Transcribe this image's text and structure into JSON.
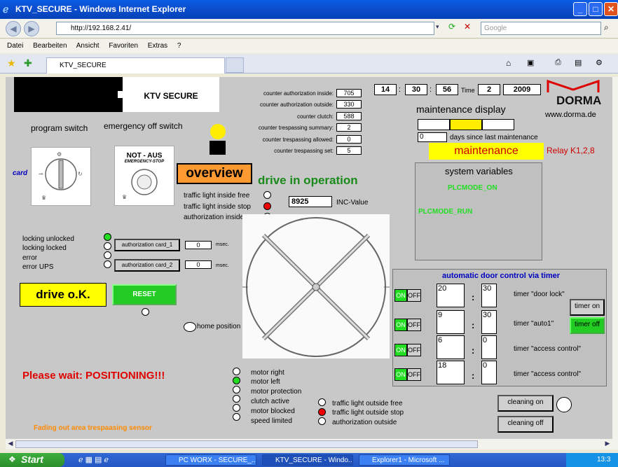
{
  "window": {
    "title": "KTV_SECURE - Windows Internet Explorer"
  },
  "browser": {
    "address": "http://192.168.2.41/",
    "search_placeholder": "Google",
    "menu": [
      "Datei",
      "Bearbeiten",
      "Ansicht",
      "Favoriten",
      "Extras",
      "?"
    ],
    "tab": "KTV_SECURE"
  },
  "page": {
    "logo_text": "KTV SECURE",
    "program_switch": "program switch",
    "emergency_switch": "emergency off switch",
    "card": "card",
    "not_aus": "NOT - AUS",
    "emergency_stop": "EMERGENCY-STOP",
    "overview": "overview",
    "drive_status": "drive in operation",
    "counters": [
      {
        "label": "counter authorization inside:",
        "value": "705"
      },
      {
        "label": "counter authorization outside:",
        "value": "330"
      },
      {
        "label": "counter clutch:",
        "value": "588"
      },
      {
        "label": "counter trespassing summary:",
        "value": "2"
      },
      {
        "label": "counter trespassing allowed:",
        "value": "0"
      },
      {
        "label": "counter trespassing set:",
        "value": "5"
      }
    ],
    "clock": {
      "hour": "14",
      "min": "30",
      "sec": "56",
      "time_label": "Time",
      "day": "2",
      "year": "2009",
      "sep": ":"
    },
    "brand": "DORMA",
    "brand_url": "www.dorma.de",
    "maintenance_display": "maintenance display",
    "days_value": "0",
    "days_label": "days since last maintenance",
    "maintenance": "maintenance",
    "relay": "Relay K1,2,8",
    "sysvars_title": "system variables",
    "plc_on": "PLCMODE_ON",
    "plc_run": "PLCMODE_RUN",
    "inside_lights": [
      "traffic light inside free",
      "traffic light inside stop",
      "authorization inside"
    ],
    "inc_value": "8925",
    "inc_label": "INC-Value",
    "lock_states": [
      "locking unlocked",
      "locking locked",
      "error",
      "error UPS"
    ],
    "auth_card_1": "authorization card_1",
    "auth_card_2": "authorization card_2",
    "auth_val_1": "0",
    "auth_val_2": "0",
    "msec": "msec.",
    "drive_ok": "drive o.K.",
    "reset": "RESET",
    "home_position": "home position",
    "please_wait": "Please wait: POSITIONING!!!",
    "fading": "Fading out area trespaasing sensor",
    "motor_states": [
      "motor right",
      "motor left",
      "motor protection",
      "clutch active",
      "motor blocked",
      "speed limited"
    ],
    "outside_lights": [
      "traffic light outside free",
      "traffic light outside stop",
      "authorization outside"
    ],
    "timer_title": "automatic door control via timer",
    "on": "ON",
    "off": "OFF",
    "timers": [
      {
        "h": "20",
        "m": "30",
        "label": "timer \"door lock\""
      },
      {
        "h": "9",
        "m": "30",
        "label": "timer \"auto1\""
      },
      {
        "h": "6",
        "m": "0",
        "label": "timer \"access control\""
      },
      {
        "h": "18",
        "m": "0",
        "label": "timer \"access control\""
      }
    ],
    "timer_on": "timer on",
    "timer_off": "timer off",
    "cleaning_on": "cleaning on",
    "cleaning_off": "cleaning off"
  },
  "taskbar": {
    "start": "Start",
    "tasks": [
      "PC WORX - SECURE_...",
      "KTV_SECURE - Windo...",
      "Explorer1 - Microsoft ..."
    ],
    "clock": "13:3"
  },
  "colors": {
    "overview_bg": "#ff9a33",
    "drive_green": "#1a8a1a",
    "maintenance_bg": "#ffff00",
    "ok_bg": "#ffff00",
    "timer_title": "#0000c0",
    "please_wait": "#e00000",
    "fading": "#ff8a00"
  }
}
